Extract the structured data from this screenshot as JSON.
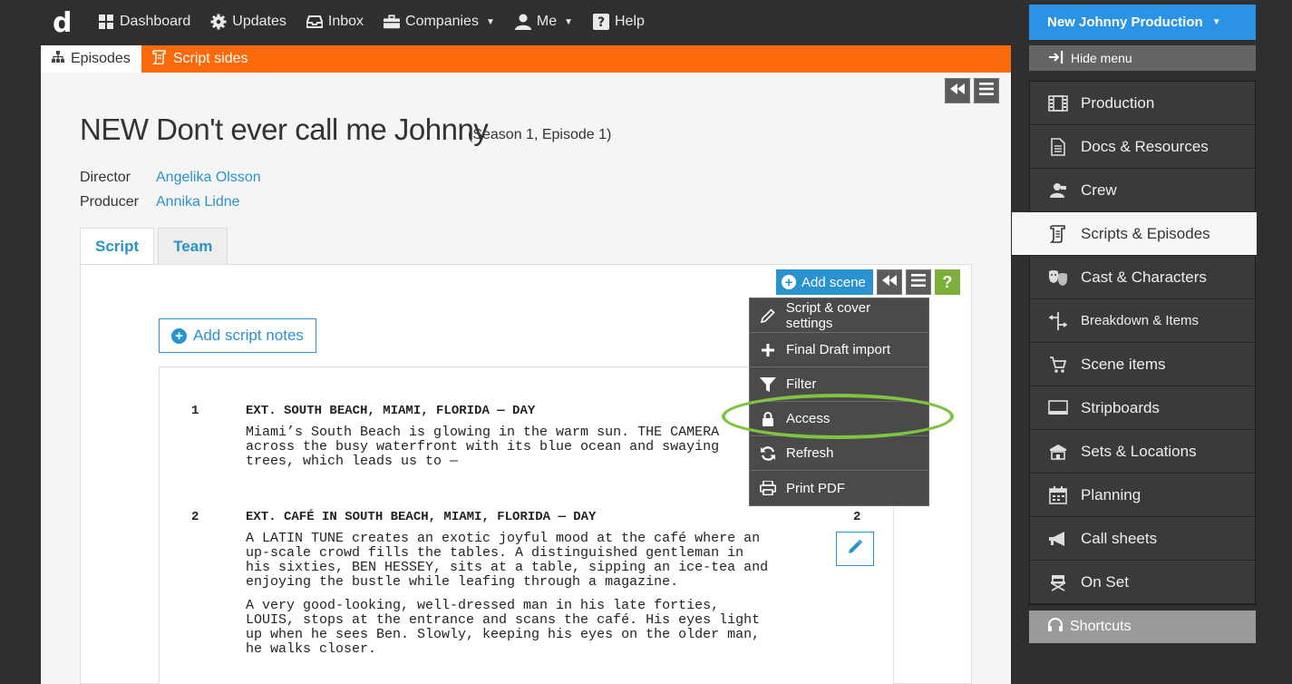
{
  "topbar": {
    "logo": "d",
    "nav": [
      {
        "label": "Dashboard",
        "icon": "dashboard-icon"
      },
      {
        "label": "Updates",
        "icon": "gear-icon"
      },
      {
        "label": "Inbox",
        "icon": "inbox-icon"
      },
      {
        "label": "Companies",
        "icon": "briefcase-icon",
        "dropdown": true
      },
      {
        "label": "Me",
        "icon": "user-icon",
        "dropdown": true
      },
      {
        "label": "Help",
        "icon": "help-icon"
      }
    ]
  },
  "subtabs": {
    "episodes": "Episodes",
    "script_sides": "Script sides"
  },
  "page": {
    "title": "NEW Don't ever call me Johnny",
    "subtitle": "(Season 1, Episode 1)",
    "director_label": "Director",
    "director": "Angelika Olsson",
    "producer_label": "Producer",
    "producer": "Annika Lidne"
  },
  "tabs": {
    "script": "Script",
    "team": "Team"
  },
  "toolbar": {
    "add_scene": "Add scene",
    "help": "?",
    "add_script_notes": "Add script notes"
  },
  "script": {
    "scenes": [
      {
        "number": "1",
        "heading": "EXT. SOUTH BEACH, MIAMI, FLORIDA — DAY",
        "paragraphs": [
          "Miami’s South Beach is glowing in the warm sun. THE CAMERA\nacross the busy waterfront with its blue ocean and swaying\ntrees, which leads us to —"
        ]
      },
      {
        "number": "2",
        "heading": "EXT. CAFÉ IN SOUTH BEACH, MIAMI, FLORIDA — DAY",
        "paragraphs": [
          "A LATIN TUNE creates an exotic joyful mood at the café where an\nup-scale crowd fills the tables. A distinguished gentleman in\nhis sixties, BEN HESSEY, sits at a table, sipping an ice-tea and\nenjoying the bustle while leafing through a magazine.",
          "A very good-looking, well-dressed man in his late forties,\nLOUIS, stops at the entrance and scans the café. His eyes light\nup when he sees Ben. Slowly, keeping his eyes on the older man,\nhe walks closer."
        ]
      }
    ],
    "right_number_2": "2"
  },
  "dropdown": [
    {
      "label": "Script & cover settings",
      "icon": "pencil-icon"
    },
    {
      "label": "Final Draft import",
      "icon": "plus-icon"
    },
    {
      "label": "Filter",
      "icon": "filter-icon"
    },
    {
      "label": "Access",
      "icon": "lock-icon"
    },
    {
      "label": "Refresh",
      "icon": "refresh-icon"
    },
    {
      "label": "Print PDF",
      "icon": "print-icon"
    }
  ],
  "sidebar": {
    "production_button": "New Johnny Production",
    "hide_menu": "Hide menu",
    "items": [
      {
        "label": "Production",
        "icon": "film-icon"
      },
      {
        "label": "Docs & Resources",
        "icon": "document-icon"
      },
      {
        "label": "Crew",
        "icon": "crew-icon"
      },
      {
        "label": "Scripts & Episodes",
        "icon": "script-icon",
        "active": true
      },
      {
        "label": "Cast & Characters",
        "icon": "masks-icon"
      },
      {
        "label": "Breakdown & Items",
        "icon": "breakdown-icon"
      },
      {
        "label": "Scene items",
        "icon": "cart-icon"
      },
      {
        "label": "Stripboards",
        "icon": "stripboard-icon"
      },
      {
        "label": "Sets & Locations",
        "icon": "location-icon"
      },
      {
        "label": "Planning",
        "icon": "calendar-icon"
      },
      {
        "label": "Call sheets",
        "icon": "megaphone-icon"
      },
      {
        "label": "On Set",
        "icon": "director-chair-icon"
      }
    ],
    "shortcuts": "Shortcuts"
  },
  "colors": {
    "accent_orange": "#fa6a0a",
    "accent_blue": "#2a93cf",
    "help_green": "#7cb03a",
    "highlight_ring": "#7ec440"
  }
}
